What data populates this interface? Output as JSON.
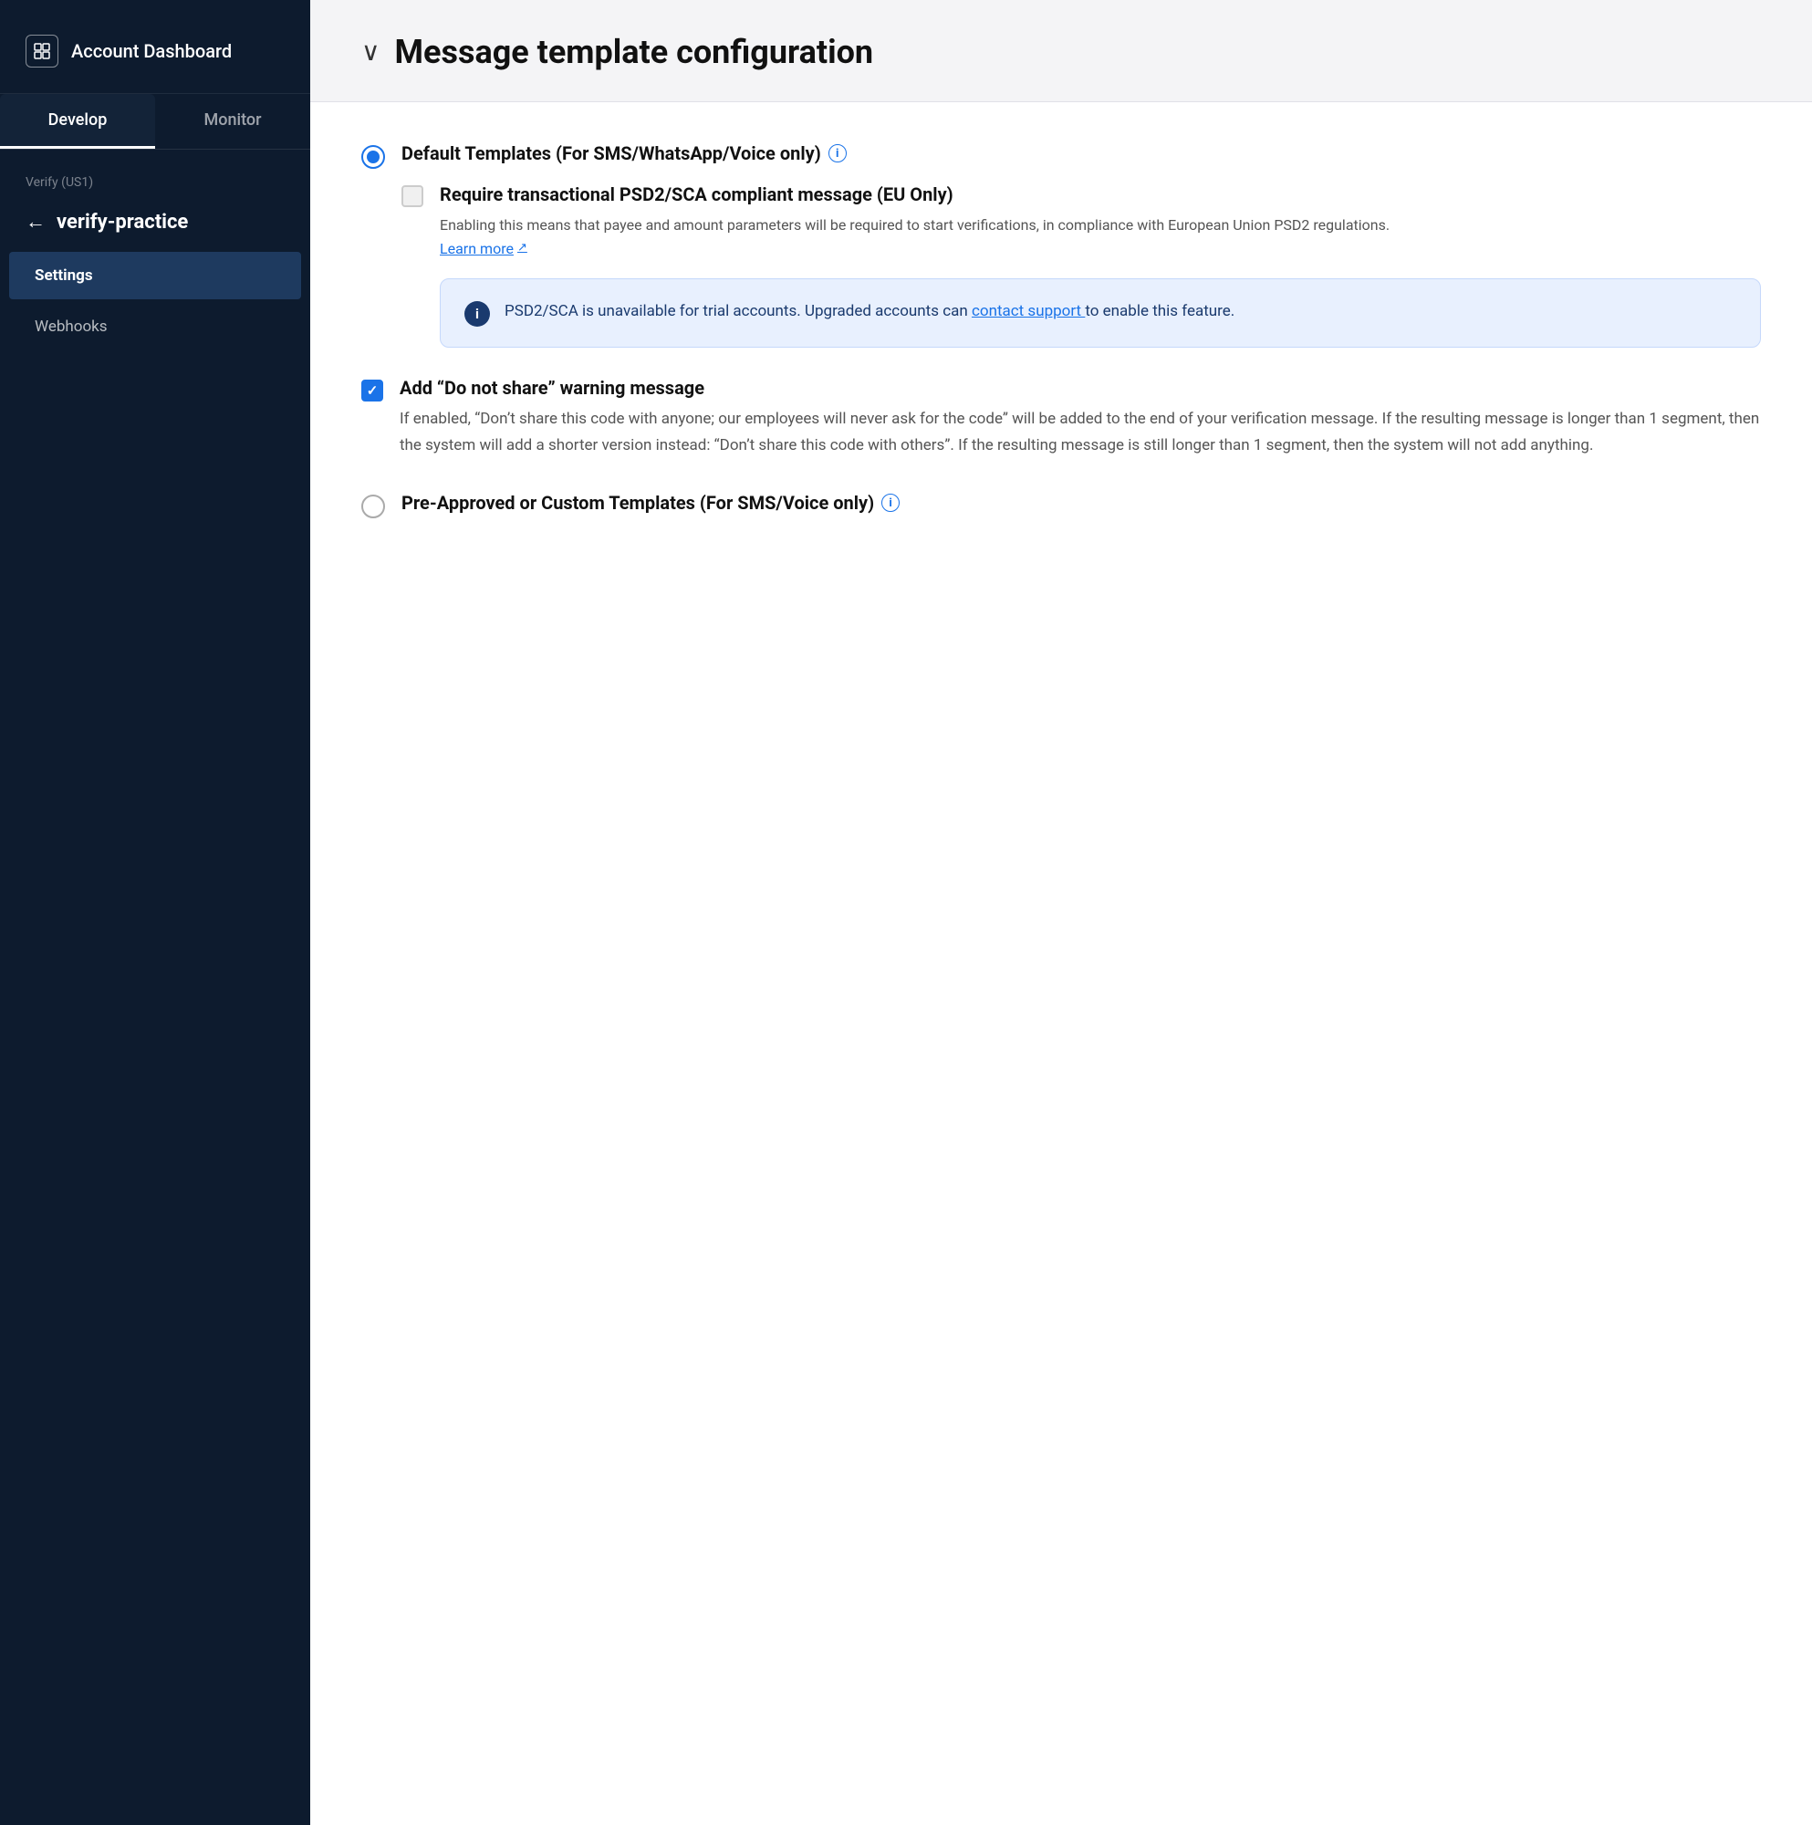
{
  "sidebar": {
    "header": {
      "title": "Account Dashboard",
      "icon_label": "dashboard-icon"
    },
    "tabs": [
      {
        "label": "Develop",
        "active": true
      },
      {
        "label": "Monitor",
        "active": false
      }
    ],
    "section_label": "Verify (US1)",
    "back_label": "verify-practice",
    "nav_items": [
      {
        "label": "Settings",
        "active": true
      },
      {
        "label": "Webhooks",
        "active": false
      }
    ]
  },
  "main": {
    "section_title": "Message template configuration",
    "chevron": "∨",
    "options": {
      "default_templates": {
        "label": "Default Templates (For SMS/WhatsApp/Voice only)",
        "has_info_icon": true,
        "checked": true,
        "nested": {
          "psd2": {
            "label": "Require transactional PSD2/SCA compliant message (EU Only)",
            "checked": false,
            "description": "Enabling this means that payee and amount parameters will be required to start verifications, in compliance with European Union PSD2 regulations.",
            "learn_more_text": "Learn more",
            "learn_more_icon": "↗"
          },
          "alert": {
            "text_before": "PSD2/SCA is unavailable for trial accounts. Upgraded accounts can ",
            "link_text": "contact support ",
            "text_after": "to enable this feature."
          }
        },
        "do_not_share": {
          "label": "Add “Do not share” warning message",
          "checked": true,
          "description": "If enabled, “Don’t share this code with anyone; our employees will never ask for the code” will be added to the end of your verification message. If the resulting message is longer than 1 segment, then the system will add a shorter version instead: “Don’t share this code with others”. If the resulting message is still longer than 1 segment, then the system will not add anything."
        }
      },
      "pre_approved": {
        "label": "Pre-Approved or Custom Templates (For SMS/Voice only)",
        "has_info_icon": true,
        "checked": false
      }
    }
  }
}
